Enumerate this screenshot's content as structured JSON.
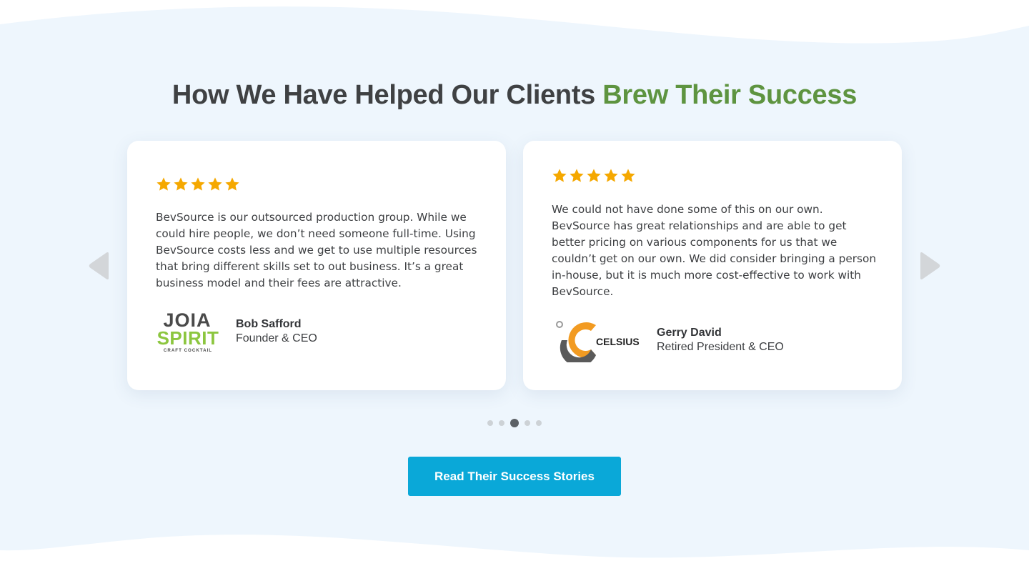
{
  "heading": {
    "main": "How We Have Helped Our Clients ",
    "accent": "Brew Their Success"
  },
  "colors": {
    "heading": "#3f4143",
    "accent": "#5e9440",
    "star": "#f5a800",
    "button": "#0aa8d8",
    "background": "#eef6fd"
  },
  "testimonials": [
    {
      "rating": 5,
      "quote": "BevSource is our outsourced production group. While we could hire people, we don’t need someone full-time. Using BevSource costs less and we get to use multiple resources that bring different skills set to out business. It’s a great business model and their fees are attractive.",
      "logo": {
        "line1": "JOIA",
        "line2": "SPIRIT",
        "line3": "CRAFT COCKTAIL"
      },
      "name": "Bob Safford",
      "role": "Founder & CEO"
    },
    {
      "rating": 5,
      "quote": "We could not have done some of this on our own. BevSource has great relationships and are able to get better pricing on various components for us that we couldn’t get on our own. We did consider bringing a person in-house, but it is much more cost-effective to work with BevSource.",
      "logo": {
        "line1": "CELSIUS"
      },
      "name": "Gerry David",
      "role": "Retired President & CEO"
    }
  ],
  "carousel": {
    "prev_icon": "chevron-left-icon",
    "next_icon": "chevron-right-icon",
    "dot_count": 5,
    "active_dot": 3
  },
  "cta": {
    "label": "Read Their Success Stories"
  }
}
